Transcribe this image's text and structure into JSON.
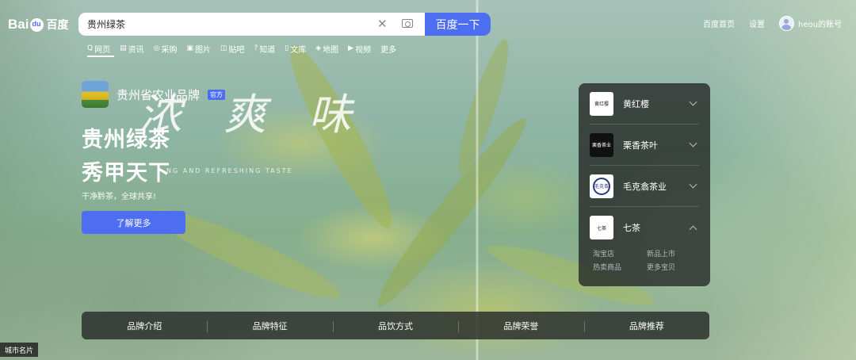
{
  "logo": {
    "text": "Bai",
    "suffix": "百度"
  },
  "search": {
    "query": "贵州绿茶",
    "button_label": "百度一下"
  },
  "top_right": {
    "home": "百度首页",
    "settings": "设置",
    "username": "heou的账号"
  },
  "tabs": [
    {
      "icon": "Q",
      "label": "网页"
    },
    {
      "icon": "▤",
      "label": "资讯"
    },
    {
      "icon": "◎",
      "label": "采购"
    },
    {
      "icon": "▣",
      "label": "图片"
    },
    {
      "icon": "◫",
      "label": "贴吧"
    },
    {
      "icon": "?",
      "label": "知道"
    },
    {
      "icon": "▯",
      "label": "文库"
    },
    {
      "icon": "◈",
      "label": "地图"
    },
    {
      "icon": "▶",
      "label": "视频"
    },
    {
      "icon": "",
      "label": "更多"
    }
  ],
  "hero": {
    "brand_name": "贵州省农业品牌",
    "badge": "官方",
    "deco_chars": "浓 爽 味",
    "deco_sub": "NG AND REFRESHING TASTE",
    "title_line1": "贵州绿茶",
    "title_line2": "秀甲天下",
    "slogan": "干净黔茶，全球共享!",
    "button_label": "了解更多"
  },
  "brand_panel": {
    "items": [
      {
        "logo_text": "黄红樱",
        "name": "黄红樱"
      },
      {
        "logo_text": "栗香茶业",
        "name": "栗香茶叶"
      },
      {
        "logo_text": "毛克翕",
        "name": "毛克翕茶业"
      },
      {
        "logo_text": "七茶",
        "name": "七茶"
      }
    ],
    "sub_links": [
      "淘宝店",
      "新品上市",
      "热卖商品",
      "更多宝贝"
    ]
  },
  "bottom_nav": [
    "品牌介绍",
    "品牌特征",
    "品饮方式",
    "品牌荣誉",
    "品牌推荐"
  ],
  "city_card": "城市名片",
  "colors": {
    "accent": "#4e6ef2",
    "panel": "#282c2a"
  }
}
